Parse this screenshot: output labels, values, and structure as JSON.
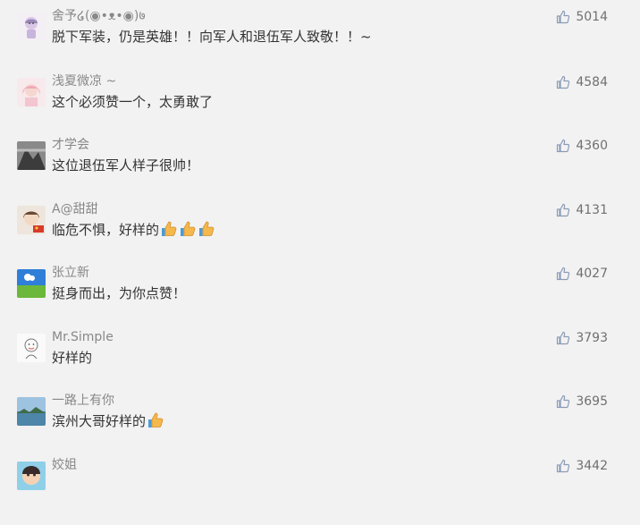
{
  "comments": [
    {
      "username": "舍予໒(◉•ᴥ•◉)७",
      "text": "脱下军装，仍是英雄！！向军人和退伍军人致敬！！~",
      "likes": "5014",
      "avatar": "cartoon-girl-avatar"
    },
    {
      "username": "浅夏微凉 ~",
      "text": "这个必须赞一个，太勇敢了",
      "likes": "4584",
      "avatar": "pink-hair-girl-avatar"
    },
    {
      "username": "才学会",
      "text": "这位退伍军人样子很帅！",
      "likes": "4360",
      "avatar": "landscape-photo-avatar"
    },
    {
      "username": "A@甜甜",
      "text": "临危不惧，好样的",
      "likes": "4131",
      "avatar": "girl-with-flag-avatar",
      "emoji_count": 3
    },
    {
      "username": "张立新",
      "text": "挺身而出，为你点赞！",
      "likes": "4027",
      "avatar": "sky-grass-avatar"
    },
    {
      "username": "Mr.Simple",
      "text": "好样的",
      "likes": "3793",
      "avatar": "sketch-avatar"
    },
    {
      "username": "一路上有你",
      "text": "滨州大哥好样的",
      "likes": "3695",
      "avatar": "lake-photo-avatar",
      "emoji_count": 1
    },
    {
      "username": "姣姐",
      "text": "",
      "likes": "3442",
      "avatar": "cartoon-face-avatar"
    }
  ],
  "icons": {
    "like": "thumbs-up-icon",
    "emoji": "thumbs-up-emoji"
  },
  "colors": {
    "background": "#f2f2f2",
    "username": "#888888",
    "text": "#333333",
    "like_icon": "#8a9bb8",
    "like_count": "#707070"
  }
}
